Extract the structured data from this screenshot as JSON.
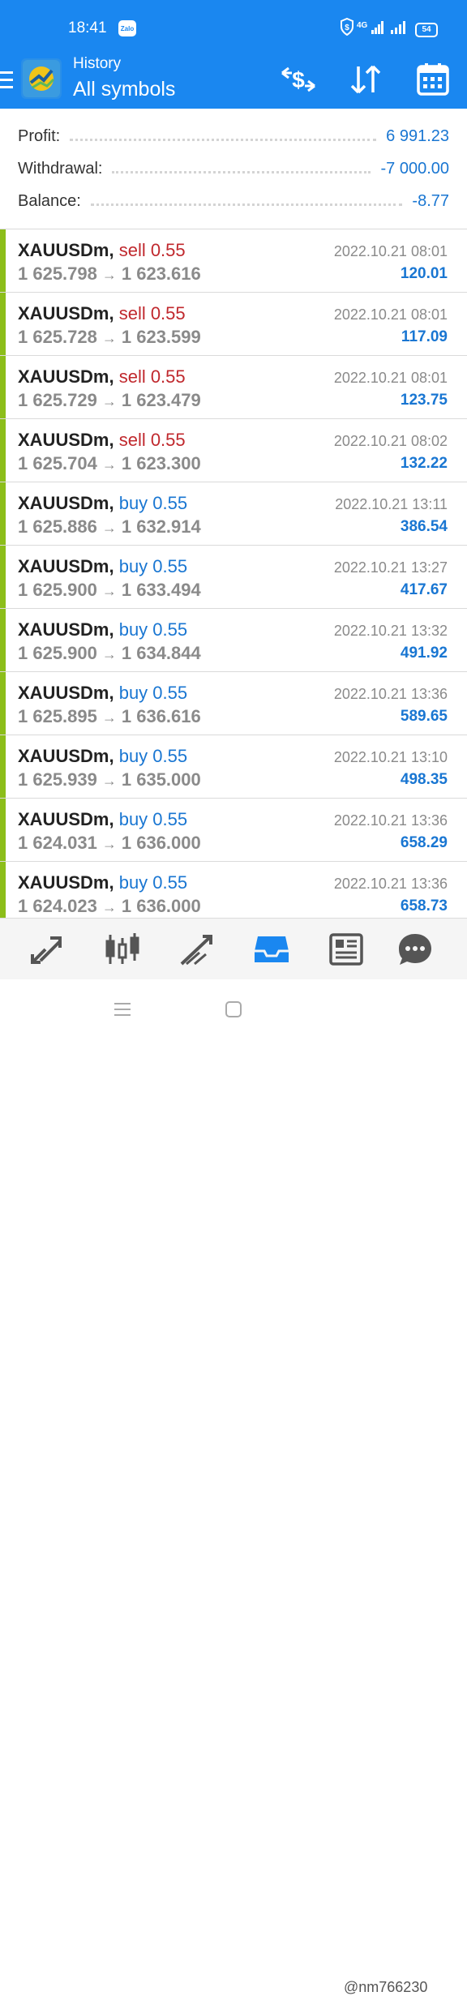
{
  "status_bar": {
    "time": "18:41",
    "zalo_label": "Zalo",
    "network_label": "4G",
    "battery": "54"
  },
  "app_bar": {
    "title": "History",
    "subtitle": "All symbols",
    "icons": [
      "menu-icon",
      "metatrader-logo",
      "currency-exchange-icon",
      "sort-icon",
      "calendar-icon"
    ]
  },
  "summary": [
    {
      "label": "Profit:",
      "value": "6 991.23"
    },
    {
      "label": "Withdrawal:",
      "value": "-7 000.00"
    },
    {
      "label": "Balance:",
      "value": "-8.77"
    }
  ],
  "deals": [
    {
      "symbol": "XAUUSDm,",
      "side": "sell 0.55",
      "type": "sell",
      "open": "1 625.798",
      "close": "1 623.616",
      "time": "2022.10.21 08:01",
      "profit": "120.01"
    },
    {
      "symbol": "XAUUSDm,",
      "side": "sell 0.55",
      "type": "sell",
      "open": "1 625.728",
      "close": "1 623.599",
      "time": "2022.10.21 08:01",
      "profit": "117.09"
    },
    {
      "symbol": "XAUUSDm,",
      "side": "sell 0.55",
      "type": "sell",
      "open": "1 625.729",
      "close": "1 623.479",
      "time": "2022.10.21 08:01",
      "profit": "123.75"
    },
    {
      "symbol": "XAUUSDm,",
      "side": "sell 0.55",
      "type": "sell",
      "open": "1 625.704",
      "close": "1 623.300",
      "time": "2022.10.21 08:02",
      "profit": "132.22"
    },
    {
      "symbol": "XAUUSDm,",
      "side": "buy 0.55",
      "type": "buy",
      "open": "1 625.886",
      "close": "1 632.914",
      "time": "2022.10.21 13:11",
      "profit": "386.54"
    },
    {
      "symbol": "XAUUSDm,",
      "side": "buy 0.55",
      "type": "buy",
      "open": "1 625.900",
      "close": "1 633.494",
      "time": "2022.10.21 13:27",
      "profit": "417.67"
    },
    {
      "symbol": "XAUUSDm,",
      "side": "buy 0.55",
      "type": "buy",
      "open": "1 625.900",
      "close": "1 634.844",
      "time": "2022.10.21 13:32",
      "profit": "491.92"
    },
    {
      "symbol": "XAUUSDm,",
      "side": "buy 0.55",
      "type": "buy",
      "open": "1 625.895",
      "close": "1 636.616",
      "time": "2022.10.21 13:36",
      "profit": "589.65"
    },
    {
      "symbol": "XAUUSDm,",
      "side": "buy 0.55",
      "type": "buy",
      "open": "1 625.939",
      "close": "1 635.000",
      "time": "2022.10.21 13:10",
      "profit": "498.35"
    },
    {
      "symbol": "XAUUSDm,",
      "side": "buy 0.55",
      "type": "buy",
      "open": "1 624.031",
      "close": "1 636.000",
      "time": "2022.10.21 13:36",
      "profit": "658.29"
    },
    {
      "symbol": "XAUUSDm,",
      "side": "buy 0.55",
      "type": "buy",
      "open": "1 624.023",
      "close": "1 636.000",
      "time": "2022.10.21 13:36",
      "profit": "658.73"
    }
  ],
  "bottom_nav": {
    "items": [
      "quotes-icon",
      "chart-icon",
      "trade-icon",
      "history-icon",
      "news-icon",
      "chat-icon"
    ],
    "active": "history-icon"
  },
  "colors": {
    "app_bar": "#1a87f0",
    "accent": "#1976d2",
    "sell": "#c0282d",
    "deal_edge": "#8cbe1a"
  },
  "watermark": "@nm766230"
}
